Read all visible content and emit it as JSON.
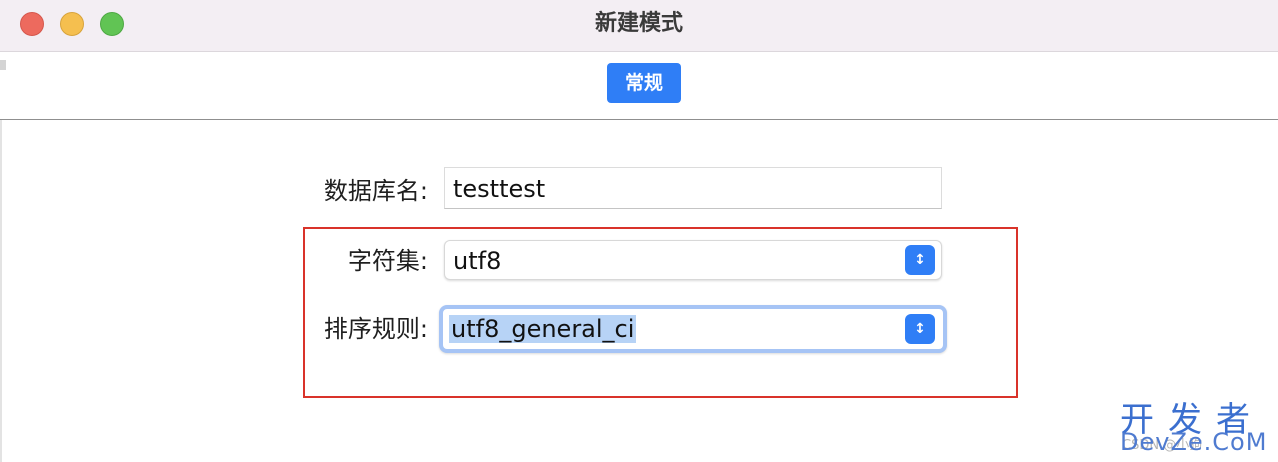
{
  "window": {
    "title": "新建模式",
    "traffic_lights": [
      "close",
      "minimize",
      "zoom"
    ]
  },
  "toolbar": {
    "tab_label": "常规",
    "tab_color": "#2f7ef6"
  },
  "form": {
    "db_name": {
      "label": "数据库名:",
      "value": "testtest"
    },
    "charset": {
      "label": "字符集:",
      "value": "utf8",
      "icon": "chevron-updown-icon"
    },
    "collation": {
      "label": "排序规则:",
      "value": "utf8_general_ci",
      "icon": "chevron-updown-icon"
    }
  },
  "highlight_color": "#d9332a",
  "watermark": {
    "text_cn": "开发者",
    "text_en": "DevZe.CoM",
    "text_csdn": "CSDN @小狗"
  }
}
